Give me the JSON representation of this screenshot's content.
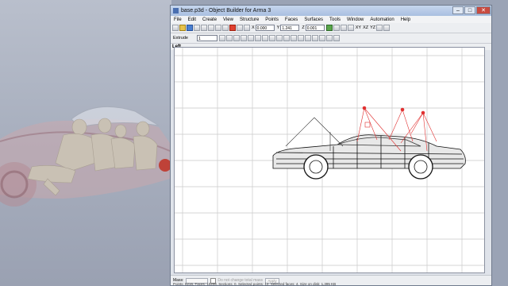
{
  "window": {
    "title": "base.p3d - Object Builder for Arma 3",
    "controls": [
      "minimize",
      "maximize",
      "close"
    ]
  },
  "menu": [
    "File",
    "Edit",
    "Create",
    "View",
    "Structure",
    "Points",
    "Faces",
    "Surfaces",
    "Tools",
    "Window",
    "Automation",
    "Help"
  ],
  "toolbar": {
    "x_label": "X",
    "x_value": "0.000",
    "y_label": "Y",
    "y_value": "1.241",
    "z_label": "Z",
    "z_value": "0.001",
    "axis_buttons": [
      "XY",
      "XZ",
      "YZ"
    ],
    "extrude_label": "Extrude",
    "extrude_value": "1"
  },
  "viewport": {
    "label": "Left"
  },
  "status": {
    "mass_label": "Mass:",
    "checkbox_label": "Do not change total mass",
    "apply_label": "Apply",
    "info": "Points: 8216, Faces: 10208, Sections: 0, Selected points: 12, Selected faces: 4, Size on disk: 1,395 KB"
  },
  "colors": {
    "window_bg": "#dfe3ea",
    "grid": "#c9c9c9",
    "selection": "#e03030"
  }
}
